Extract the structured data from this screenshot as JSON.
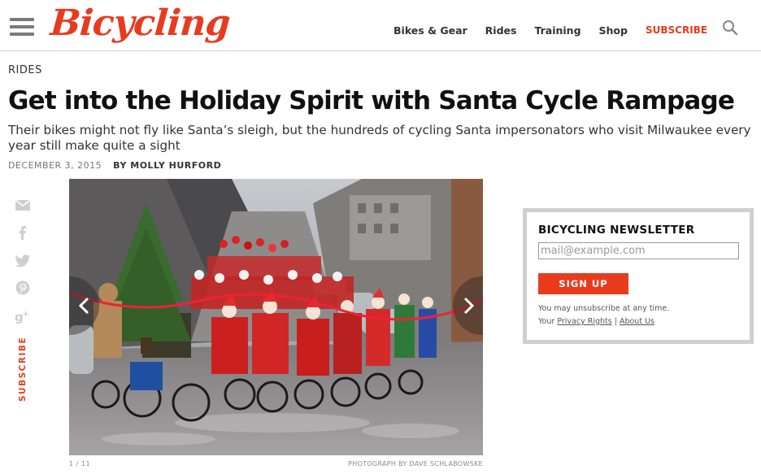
{
  "header": {
    "logo": "Bicycling",
    "nav": [
      "Bikes & Gear",
      "Rides",
      "Training",
      "Shop"
    ],
    "subscribe": "SUBSCRIBE"
  },
  "article": {
    "section": "RIDES",
    "headline": "Get into the Holiday Spirit with Santa Cycle Rampage",
    "dek": "Their bikes might not fly like Santa’s sleigh, but the hundreds of cycling Santa impersonators who visit Milwaukee every year still make quite a sight",
    "date": "DECEMBER 3, 2015",
    "byline": "BY MOLLY HURFORD"
  },
  "share": {
    "icons": [
      "email-icon",
      "facebook-icon",
      "twitter-icon",
      "pinterest-icon",
      "google-plus-icon"
    ],
    "subscribe": "SUBSCRIBE"
  },
  "gallery": {
    "counter": "1 / 11",
    "credit": "PHOTOGRAPH BY DAVE SCHLABOWSKE"
  },
  "newsletter": {
    "title": "BICYCLING NEWSLETTER",
    "placeholder": "mail@example.com",
    "button": "SIGN UP",
    "note": "You may unsubscribe at any time.",
    "your": "Your",
    "privacy": "Privacy Rights",
    "sep": "|",
    "about": "About Us"
  },
  "colors": {
    "brand": "#e83b1e",
    "border": "#cfcfcf"
  }
}
